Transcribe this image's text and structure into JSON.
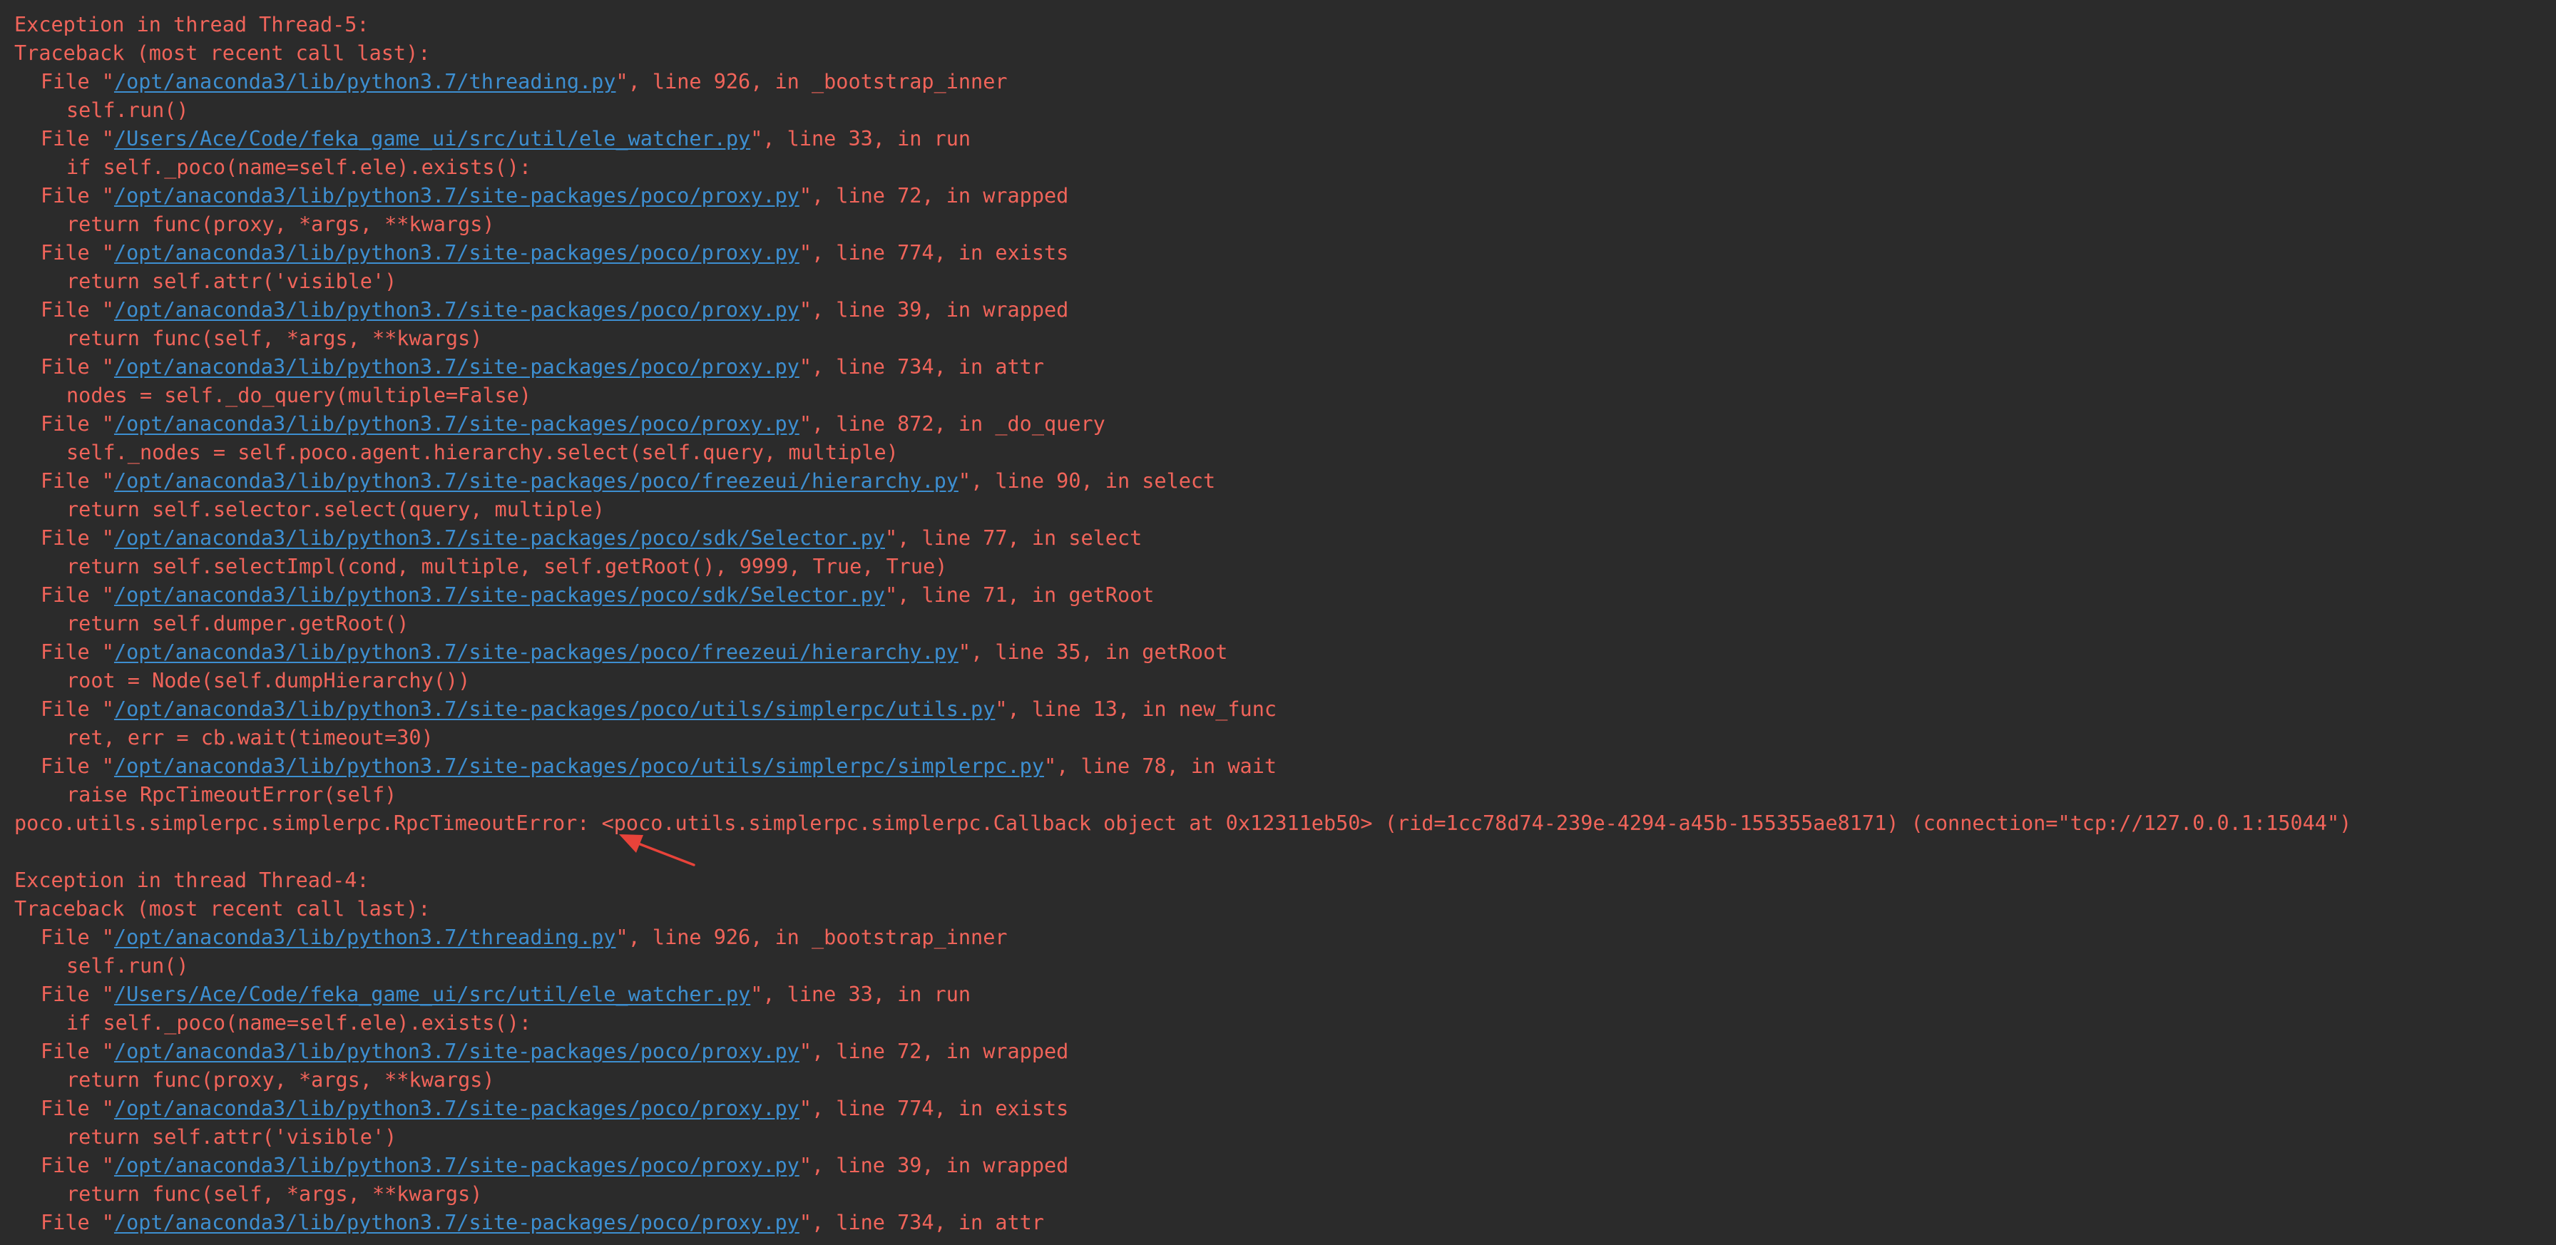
{
  "console": {
    "accent_text_color": "#f0645a",
    "link_color": "#3d8fd1",
    "background_color": "#2b2b2b",
    "lines": [
      {
        "type": "text",
        "indent": 0,
        "text": "Exception in thread Thread-5:"
      },
      {
        "type": "text",
        "indent": 0,
        "text": "Traceback (most recent call last):"
      },
      {
        "type": "file",
        "path": "/opt/anaconda3/lib/python3.7/threading.py",
        "suffix": "\", line 926, in _bootstrap_inner"
      },
      {
        "type": "text",
        "indent": 2,
        "text": "self.run()"
      },
      {
        "type": "file",
        "path": "/Users/Ace/Code/feka_game_ui/src/util/ele_watcher.py",
        "suffix": "\", line 33, in run"
      },
      {
        "type": "text",
        "indent": 2,
        "text": "if self._poco(name=self.ele).exists():"
      },
      {
        "type": "file",
        "path": "/opt/anaconda3/lib/python3.7/site-packages/poco/proxy.py",
        "suffix": "\", line 72, in wrapped"
      },
      {
        "type": "text",
        "indent": 2,
        "text": "return func(proxy, *args, **kwargs)"
      },
      {
        "type": "file",
        "path": "/opt/anaconda3/lib/python3.7/site-packages/poco/proxy.py",
        "suffix": "\", line 774, in exists"
      },
      {
        "type": "text",
        "indent": 2,
        "text": "return self.attr('visible')"
      },
      {
        "type": "file",
        "path": "/opt/anaconda3/lib/python3.7/site-packages/poco/proxy.py",
        "suffix": "\", line 39, in wrapped"
      },
      {
        "type": "text",
        "indent": 2,
        "text": "return func(self, *args, **kwargs)"
      },
      {
        "type": "file",
        "path": "/opt/anaconda3/lib/python3.7/site-packages/poco/proxy.py",
        "suffix": "\", line 734, in attr"
      },
      {
        "type": "text",
        "indent": 2,
        "text": "nodes = self._do_query(multiple=False)"
      },
      {
        "type": "file",
        "path": "/opt/anaconda3/lib/python3.7/site-packages/poco/proxy.py",
        "suffix": "\", line 872, in _do_query"
      },
      {
        "type": "text",
        "indent": 2,
        "text": "self._nodes = self.poco.agent.hierarchy.select(self.query, multiple)"
      },
      {
        "type": "file",
        "path": "/opt/anaconda3/lib/python3.7/site-packages/poco/freezeui/hierarchy.py",
        "suffix": "\", line 90, in select"
      },
      {
        "type": "text",
        "indent": 2,
        "text": "return self.selector.select(query, multiple)"
      },
      {
        "type": "file",
        "path": "/opt/anaconda3/lib/python3.7/site-packages/poco/sdk/Selector.py",
        "suffix": "\", line 77, in select"
      },
      {
        "type": "text",
        "indent": 2,
        "text": "return self.selectImpl(cond, multiple, self.getRoot(), 9999, True, True)"
      },
      {
        "type": "file",
        "path": "/opt/anaconda3/lib/python3.7/site-packages/poco/sdk/Selector.py",
        "suffix": "\", line 71, in getRoot"
      },
      {
        "type": "text",
        "indent": 2,
        "text": "return self.dumper.getRoot()"
      },
      {
        "type": "file",
        "path": "/opt/anaconda3/lib/python3.7/site-packages/poco/freezeui/hierarchy.py",
        "suffix": "\", line 35, in getRoot"
      },
      {
        "type": "text",
        "indent": 2,
        "text": "root = Node(self.dumpHierarchy())"
      },
      {
        "type": "file",
        "path": "/opt/anaconda3/lib/python3.7/site-packages/poco/utils/simplerpc/utils.py",
        "suffix": "\", line 13, in new_func"
      },
      {
        "type": "text",
        "indent": 2,
        "text": "ret, err = cb.wait(timeout=30)"
      },
      {
        "type": "file",
        "path": "/opt/anaconda3/lib/python3.7/site-packages/poco/utils/simplerpc/simplerpc.py",
        "suffix": "\", line 78, in wait"
      },
      {
        "type": "text",
        "indent": 2,
        "text": "raise RpcTimeoutError(self)"
      },
      {
        "type": "text",
        "indent": 0,
        "text": "poco.utils.simplerpc.simplerpc.RpcTimeoutError: <poco.utils.simplerpc.simplerpc.Callback object at 0x12311eb50> (rid=1cc78d74-239e-4294-a45b-155355ae8171) (connection=\"tcp://127.0.0.1:15044\")"
      },
      {
        "type": "text",
        "indent": 0,
        "text": ""
      },
      {
        "type": "text",
        "indent": 0,
        "text": "Exception in thread Thread-4:"
      },
      {
        "type": "text",
        "indent": 0,
        "text": "Traceback (most recent call last):"
      },
      {
        "type": "file",
        "path": "/opt/anaconda3/lib/python3.7/threading.py",
        "suffix": "\", line 926, in _bootstrap_inner"
      },
      {
        "type": "text",
        "indent": 2,
        "text": "self.run()"
      },
      {
        "type": "file",
        "path": "/Users/Ace/Code/feka_game_ui/src/util/ele_watcher.py",
        "suffix": "\", line 33, in run"
      },
      {
        "type": "text",
        "indent": 2,
        "text": "if self._poco(name=self.ele).exists():"
      },
      {
        "type": "file",
        "path": "/opt/anaconda3/lib/python3.7/site-packages/poco/proxy.py",
        "suffix": "\", line 72, in wrapped"
      },
      {
        "type": "text",
        "indent": 2,
        "text": "return func(proxy, *args, **kwargs)"
      },
      {
        "type": "file",
        "path": "/opt/anaconda3/lib/python3.7/site-packages/poco/proxy.py",
        "suffix": "\", line 774, in exists"
      },
      {
        "type": "text",
        "indent": 2,
        "text": "return self.attr('visible')"
      },
      {
        "type": "file",
        "path": "/opt/anaconda3/lib/python3.7/site-packages/poco/proxy.py",
        "suffix": "\", line 39, in wrapped"
      },
      {
        "type": "text",
        "indent": 2,
        "text": "return func(self, *args, **kwargs)"
      },
      {
        "type": "file",
        "path": "/opt/anaconda3/lib/python3.7/site-packages/poco/proxy.py",
        "suffix": "\", line 734, in attr"
      }
    ],
    "file_prefix": "File \""
  },
  "annotation": {
    "arrow_color": "#e8433a"
  }
}
